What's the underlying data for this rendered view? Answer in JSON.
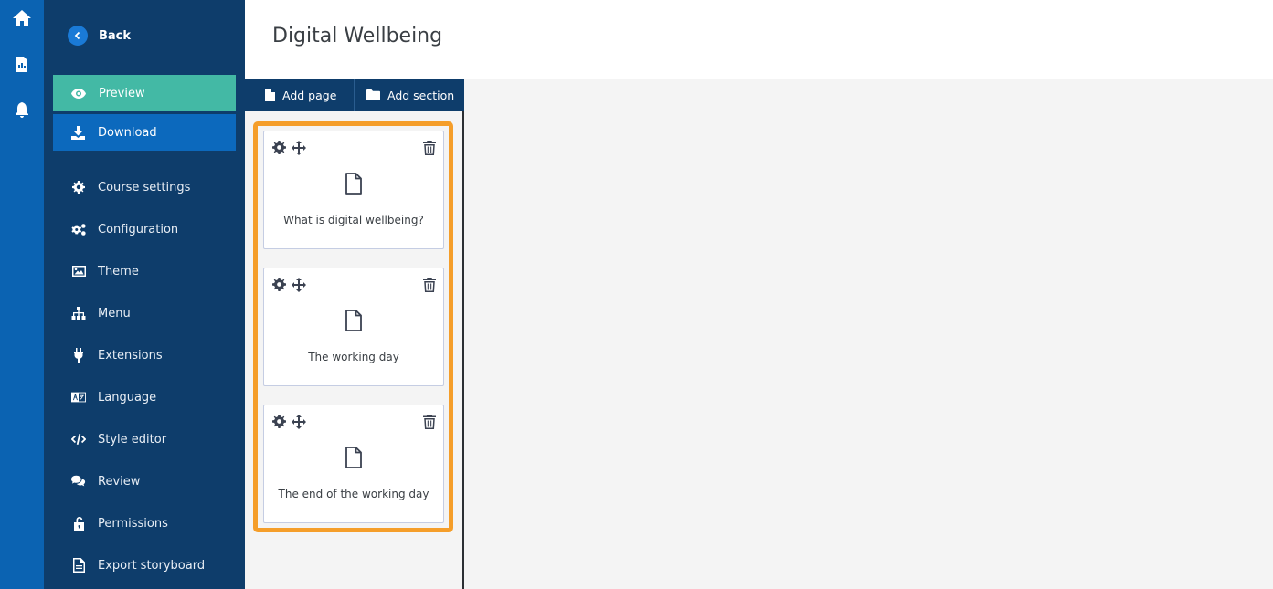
{
  "app": {
    "title": "Digital Wellbeing"
  },
  "rail": {
    "icons": [
      "home-icon",
      "document-chart-icon",
      "bell-icon"
    ]
  },
  "sidebar": {
    "back_label": "Back",
    "preview_label": "Preview",
    "download_label": "Download",
    "items": [
      {
        "label": "Course settings",
        "icon": "gear-icon"
      },
      {
        "label": "Configuration",
        "icon": "gears-icon"
      },
      {
        "label": "Theme",
        "icon": "image-icon"
      },
      {
        "label": "Menu",
        "icon": "sitemap-icon"
      },
      {
        "label": "Extensions",
        "icon": "plug-icon"
      },
      {
        "label": "Language",
        "icon": "language-icon"
      },
      {
        "label": "Style editor",
        "icon": "code-icon"
      },
      {
        "label": "Review",
        "icon": "comments-icon"
      },
      {
        "label": "Permissions",
        "icon": "unlock-icon"
      },
      {
        "label": "Export storyboard",
        "icon": "file-export-icon"
      }
    ]
  },
  "toolbar": {
    "add_page_label": "Add page",
    "add_section_label": "Add section"
  },
  "pages": [
    {
      "title": "What is digital wellbeing?"
    },
    {
      "title": "The working day"
    },
    {
      "title": "The end of the working day"
    }
  ],
  "colors": {
    "rail": "#0b63b2",
    "sidebar": "#0e3d6b",
    "preview": "#43b9a5",
    "download": "#0c69bd",
    "highlight": "#f59e2a"
  }
}
